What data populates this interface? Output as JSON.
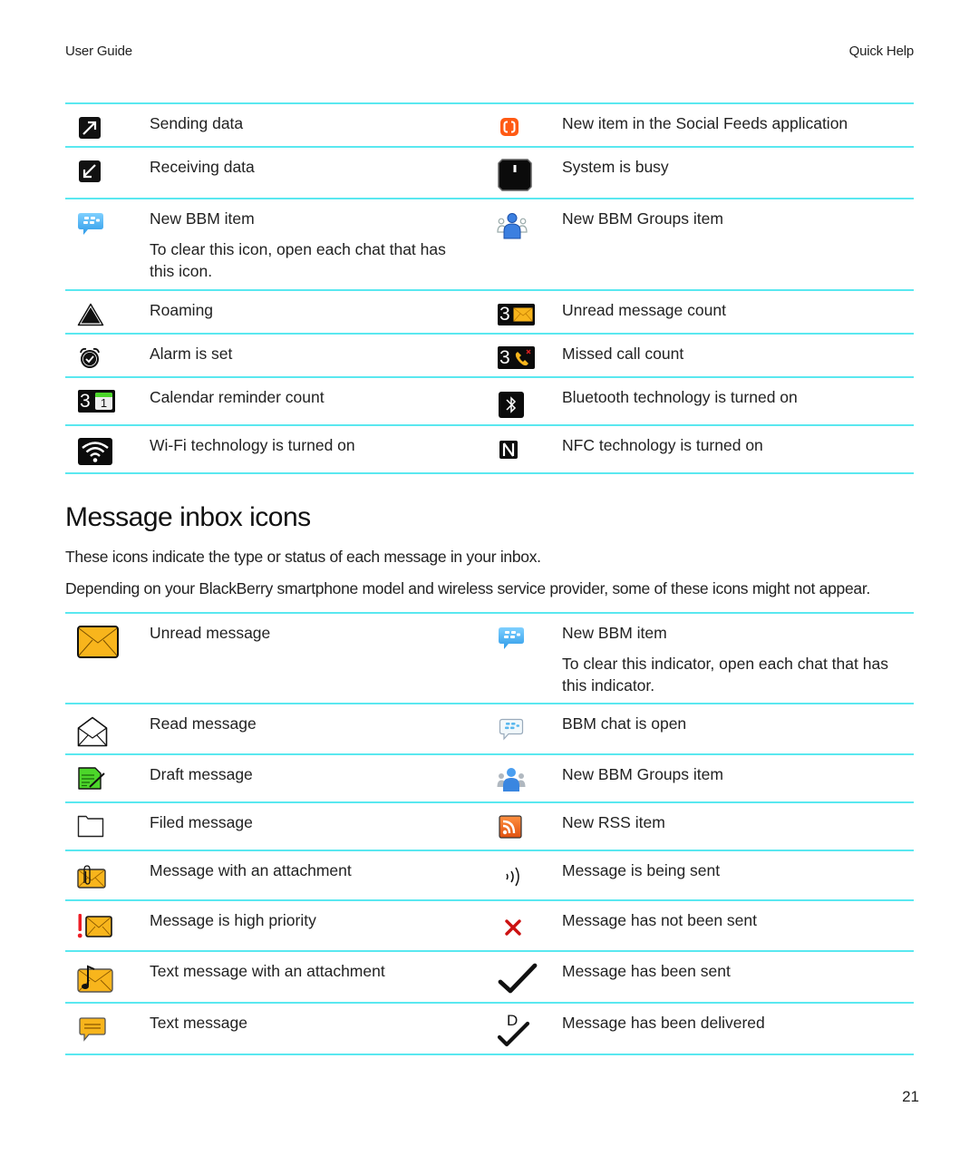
{
  "header": {
    "left": "User Guide",
    "right": "Quick Help"
  },
  "status_icons": [
    {
      "left": {
        "icon": "sending-data-icon",
        "label": "Sending data"
      },
      "right": {
        "icon": "social-feeds-icon",
        "label": "New item in the Social Feeds application"
      }
    },
    {
      "left": {
        "icon": "receiving-data-icon",
        "label": "Receiving data"
      },
      "right": {
        "icon": "system-busy-icon",
        "label": "System is busy"
      }
    },
    {
      "left": {
        "icon": "bbm-item-icon",
        "label": "New BBM item",
        "note": "To clear this icon, open each chat that has this icon."
      },
      "right": {
        "icon": "bbm-groups-icon",
        "label": "New BBM Groups item"
      }
    },
    {
      "left": {
        "icon": "roaming-icon",
        "label": "Roaming"
      },
      "right": {
        "icon": "unread-count-icon",
        "label": "Unread message count",
        "count": "3"
      }
    },
    {
      "left": {
        "icon": "alarm-icon",
        "label": "Alarm is set"
      },
      "right": {
        "icon": "missed-call-count-icon",
        "label": "Missed call count",
        "count": "3"
      }
    },
    {
      "left": {
        "icon": "calendar-count-icon",
        "label": "Calendar reminder count",
        "count": "3",
        "day": "1"
      },
      "right": {
        "icon": "bluetooth-icon",
        "label": "Bluetooth technology is turned on"
      }
    },
    {
      "left": {
        "icon": "wifi-icon",
        "label": "Wi-Fi technology is turned on"
      },
      "right": {
        "icon": "nfc-icon",
        "label": "NFC technology is turned on"
      }
    }
  ],
  "section": {
    "title": "Message inbox icons",
    "intro": "These icons indicate the type or status of each message in your inbox.",
    "note": "Depending on your BlackBerry smartphone model and wireless service provider, some of these icons might not appear."
  },
  "inbox_icons": [
    {
      "left": {
        "icon": "unread-message-icon",
        "label": "Unread message"
      },
      "right": {
        "icon": "bbm-item-icon",
        "label": "New BBM item",
        "note": "To clear this indicator, open each chat that has this indicator."
      }
    },
    {
      "left": {
        "icon": "read-message-icon",
        "label": "Read message"
      },
      "right": {
        "icon": "bbm-chat-open-icon",
        "label": "BBM chat is open"
      }
    },
    {
      "left": {
        "icon": "draft-message-icon",
        "label": "Draft message"
      },
      "right": {
        "icon": "bbm-groups-icon",
        "label": "New BBM Groups item"
      }
    },
    {
      "left": {
        "icon": "filed-message-icon",
        "label": "Filed message"
      },
      "right": {
        "icon": "rss-icon",
        "label": "New RSS item"
      }
    },
    {
      "left": {
        "icon": "attachment-message-icon",
        "label": "Message with an attachment"
      },
      "right": {
        "icon": "sending-icon",
        "label": "Message is being sent"
      }
    },
    {
      "left": {
        "icon": "high-priority-icon",
        "label": "Message is high priority"
      },
      "right": {
        "icon": "not-sent-icon",
        "label": "Message has not been sent"
      }
    },
    {
      "left": {
        "icon": "text-attachment-icon",
        "label": "Text message with an attachment"
      },
      "right": {
        "icon": "sent-icon",
        "label": "Message has been sent"
      }
    },
    {
      "left": {
        "icon": "text-message-icon",
        "label": "Text message"
      },
      "right": {
        "icon": "delivered-icon",
        "label": "Message has been delivered",
        "mark": "D"
      }
    }
  ],
  "colors": {
    "rule": "#5ae8f0",
    "envelope": "#f8b51c",
    "bbm_blue": "#3ea6f0",
    "social_orange": "#ff5a14",
    "error_red": "#cc1111",
    "draft_green": "#4cd62a"
  },
  "page_number": "21"
}
